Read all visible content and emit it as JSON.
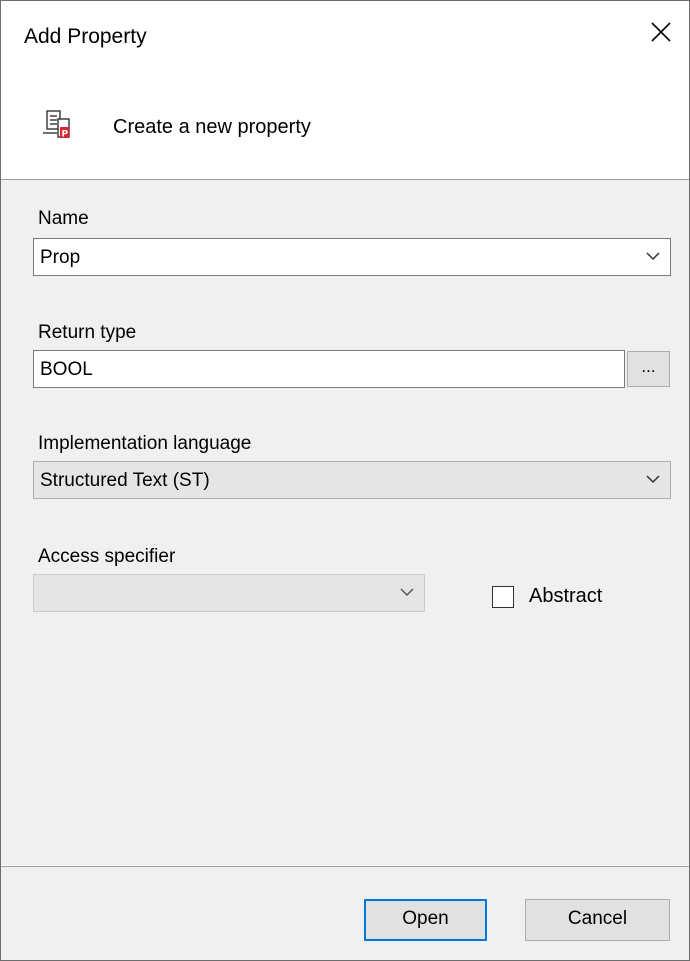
{
  "dialog": {
    "title": "Add Property",
    "close_icon": "close-icon"
  },
  "header": {
    "icon": "property-icon",
    "text": "Create a new property"
  },
  "form": {
    "name_label": "Name",
    "name_value": "Prop",
    "return_type_label": "Return type",
    "return_type_value": "BOOL",
    "browse_label": "...",
    "impl_language_label": "Implementation language",
    "impl_language_value": "Structured Text (ST)",
    "access_specifier_label": "Access specifier",
    "access_specifier_value": "",
    "abstract_label": "Abstract",
    "abstract_checked": false
  },
  "footer": {
    "open_label": "Open",
    "cancel_label": "Cancel"
  },
  "colors": {
    "accent": "#0078d7",
    "panel": "#f0f0f0",
    "icon_red": "#e0222a"
  }
}
